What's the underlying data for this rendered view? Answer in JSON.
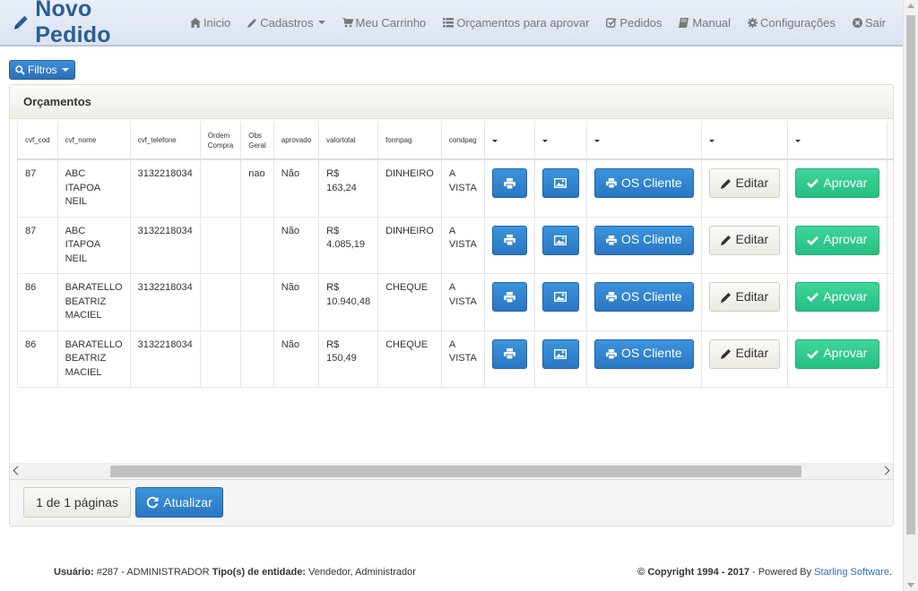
{
  "brand": {
    "title": "Novo Pedido"
  },
  "nav": {
    "items": [
      {
        "label": "Inicio",
        "icon": "home-icon"
      },
      {
        "label": "Cadastros",
        "icon": "pencil-icon"
      },
      {
        "label": "Meu Carrinho",
        "icon": "cart-icon"
      },
      {
        "label": "Orçamentos para aprovar",
        "icon": "list-icon"
      },
      {
        "label": "Pedidos",
        "icon": "check-square-icon"
      },
      {
        "label": "Manual",
        "icon": "book-icon"
      },
      {
        "label": "Configurações",
        "icon": "gear-icon"
      },
      {
        "label": "Sair",
        "icon": "close-circle-icon"
      }
    ]
  },
  "filters": {
    "label": "Filtros"
  },
  "panel": {
    "title": "Orçamentos"
  },
  "table": {
    "headers": {
      "cvf_cod": "cvf_cod",
      "cvf_nome": "cvf_nome",
      "cvf_telefone": "cvf_telefone",
      "ordem_compra_1": "Ordem",
      "ordem_compra_2": "Compra",
      "obs_geral_1": "Obs",
      "obs_geral_2": "Geral",
      "aprovado": "aprovado",
      "valortotal": "valortotal",
      "formpag": "formpag",
      "condpag": "condpag"
    },
    "rows": [
      {
        "cod": "87",
        "nome_1": "ABC",
        "nome_2": "ITAPOA NEIL",
        "nome_3": "",
        "telefone": "3132218034",
        "ordem": "",
        "obs": "nao",
        "aprovado": "Não",
        "valor_1": "R$",
        "valor_2": "163,24",
        "formpag": "DINHEIRO",
        "cond_1": "A",
        "cond_2": "VISTA"
      },
      {
        "cod": "87",
        "nome_1": "ABC",
        "nome_2": "ITAPOA NEIL",
        "nome_3": "",
        "telefone": "3132218034",
        "ordem": "",
        "obs": "",
        "aprovado": "Não",
        "valor_1": "R$",
        "valor_2": "4.085,19",
        "formpag": "DINHEIRO",
        "cond_1": "A",
        "cond_2": "VISTA"
      },
      {
        "cod": "86",
        "nome_1": "BARATELLO",
        "nome_2": "BEATRIZ",
        "nome_3": "MACIEL",
        "telefone": "3132218034",
        "ordem": "",
        "obs": "",
        "aprovado": "Não",
        "valor_1": "R$",
        "valor_2": "10.940,48",
        "formpag": "CHEQUE",
        "cond_1": "A",
        "cond_2": "VISTA"
      },
      {
        "cod": "86",
        "nome_1": "BARATELLO",
        "nome_2": "BEATRIZ",
        "nome_3": "MACIEL",
        "telefone": "3132218034",
        "ordem": "",
        "obs": "",
        "aprovado": "Não",
        "valor_1": "R$",
        "valor_2": "150,49",
        "formpag": "CHEQUE",
        "cond_1": "A",
        "cond_2": "VISTA"
      }
    ],
    "buttons": {
      "os_cliente": "OS Cliente",
      "editar": "Editar",
      "aprovar": "Aprovar"
    }
  },
  "pagination": {
    "label": "1 de 1 páginas",
    "refresh": "Atualizar"
  },
  "footer": {
    "user_label": "Usuário:",
    "user_value": "#287 - ADMINISTRADOR",
    "entity_label": "Tipo(s) de entidade:",
    "entity_value": "Vendedor, Administrador",
    "copyright": "© Copyright 1994 - 2017",
    "powered": " - Powered By ",
    "company": "Starling Software",
    "dot": "."
  },
  "colors": {
    "brand": "#2a5f91",
    "primary": "#2a77c3",
    "success": "#25bf83",
    "danger": "#e9643c"
  }
}
